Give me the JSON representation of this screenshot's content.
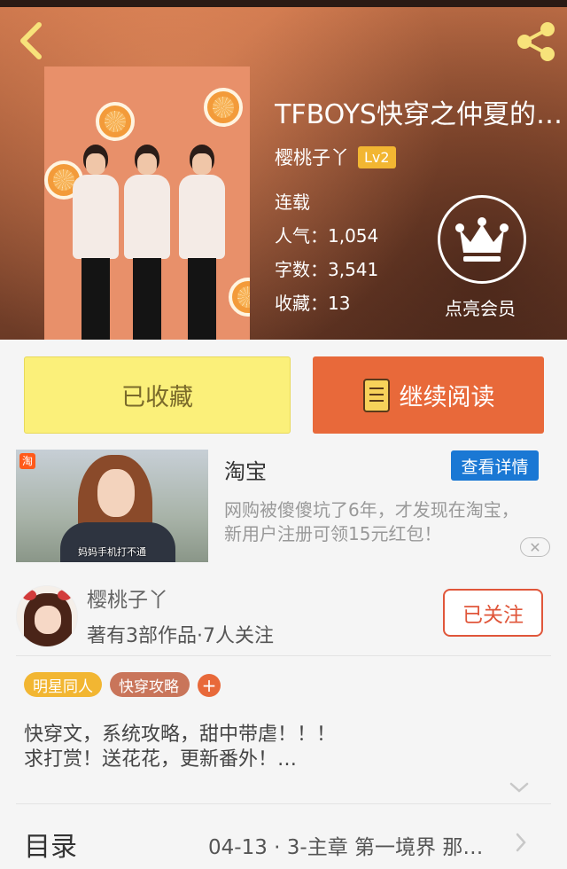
{
  "book": {
    "title": "TFBOYS快穿之仲夏的…",
    "author": "樱桃子丫",
    "level": "Lv2",
    "status": "连载",
    "popularity": "人气：1,054",
    "word_count": "字数：3,541",
    "favorites": "收藏：13",
    "vip_label": "点亮会员"
  },
  "actions": {
    "favorited_label": "已收藏",
    "continue_label": "继续阅读"
  },
  "ad": {
    "brand": "淘宝",
    "brand_icon": "淘",
    "detail_label": "查看详情",
    "description": "网购被傻傻坑了6年，才发现在淘宝，新用户注册可领15元红包！",
    "image_caption": "妈妈手机打不通"
  },
  "author": {
    "name": "樱桃子丫",
    "stats": "著有3部作品·7人关注",
    "follow_label": "已关注"
  },
  "tags": [
    "明星同人",
    "快穿攻略"
  ],
  "tag_add": "+",
  "description": {
    "line1": "快穿文，系统攻略，甜中带虐！！！",
    "line2": "求打赏！送花花，更新番外！…"
  },
  "toc": {
    "title": "目录",
    "latest": "04-13 · 3-主章 第一境界 那…"
  },
  "icons": {
    "back": "chevron-left-icon",
    "share": "share-icon",
    "crown": "crown-icon",
    "book": "book-icon",
    "close": "close-icon",
    "expand": "chevron-down-icon",
    "more": "chevron-right-icon"
  },
  "colors": {
    "accent_orange": "#e8693a",
    "favorited_yellow": "#fbf07a",
    "level_badge": "#f2b632",
    "ad_blue": "#1a78d4",
    "follow_red": "#e0563a"
  }
}
